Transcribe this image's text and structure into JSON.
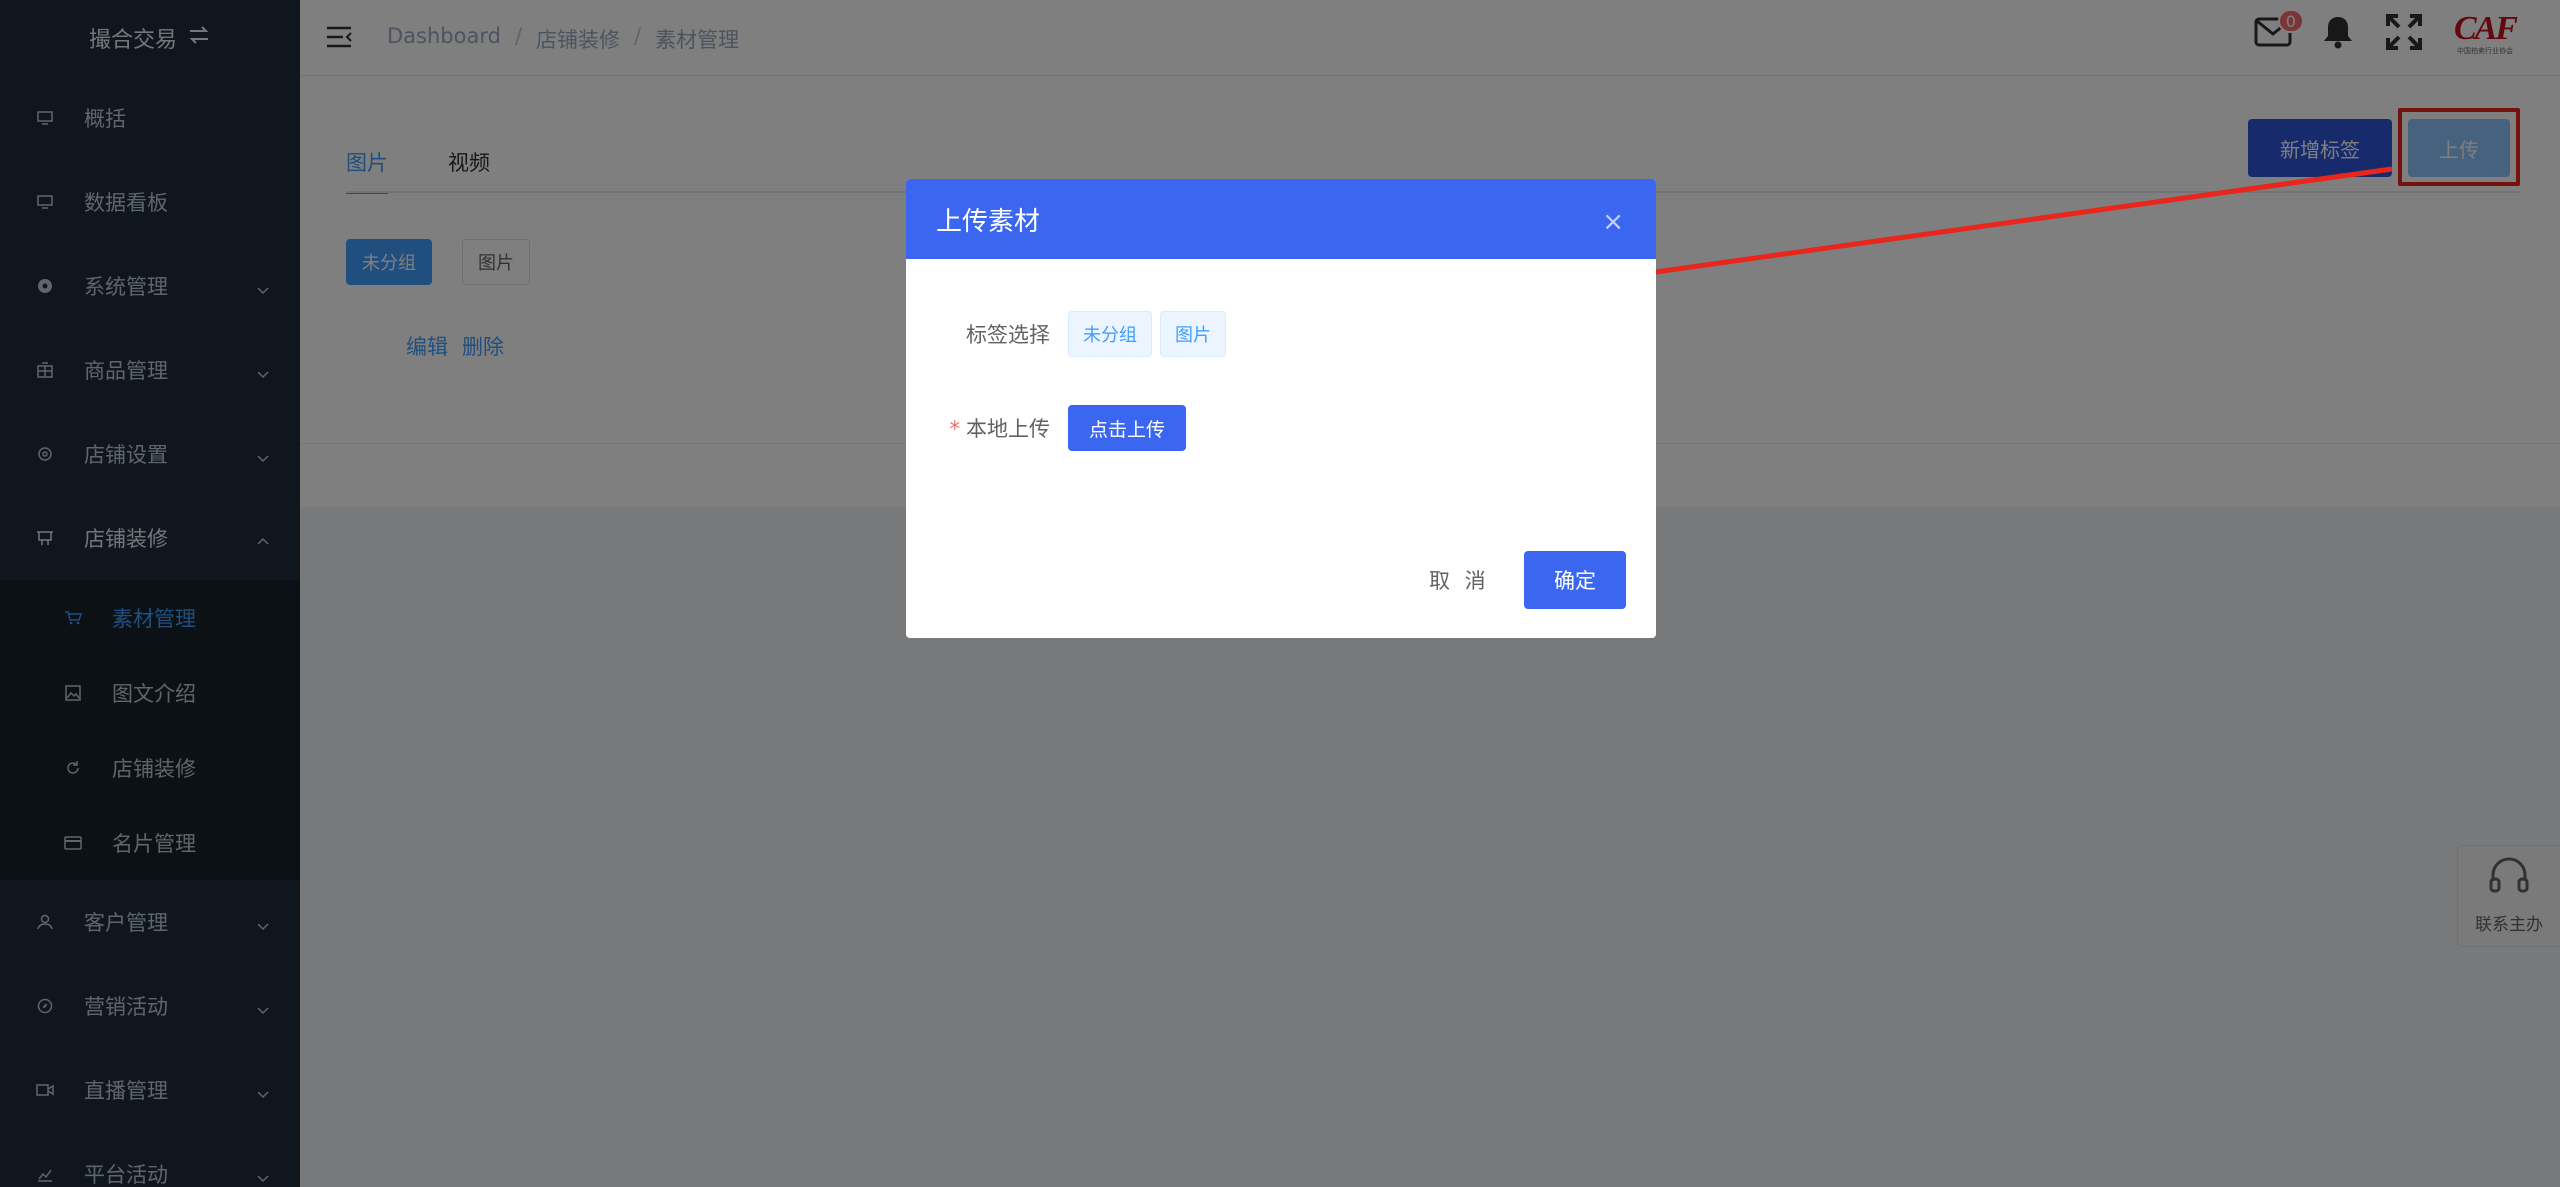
{
  "brand": {
    "label": "撮合交易"
  },
  "sidebar": {
    "items": [
      {
        "label": "概括",
        "icon": "monitor-icon"
      },
      {
        "label": "数据看板",
        "icon": "monitor-icon"
      },
      {
        "label": "系统管理",
        "icon": "settings-circle-icon"
      },
      {
        "label": "商品管理",
        "icon": "grid-icon"
      },
      {
        "label": "店铺设置",
        "icon": "gear-icon"
      },
      {
        "label": "店铺装修",
        "icon": "shop-icon"
      }
    ],
    "subitems": [
      {
        "label": "素材管理",
        "icon": "cart-icon",
        "active": true
      },
      {
        "label": "图文介绍",
        "icon": "image-icon"
      },
      {
        "label": "店铺装修",
        "icon": "refresh-icon"
      },
      {
        "label": "名片管理",
        "icon": "card-icon"
      }
    ],
    "items_after": [
      {
        "label": "客户管理",
        "icon": "user-icon"
      },
      {
        "label": "营销活动",
        "icon": "compass-icon"
      },
      {
        "label": "直播管理",
        "icon": "video-icon"
      },
      {
        "label": "平台活动",
        "icon": "chart-icon"
      }
    ]
  },
  "breadcrumb": [
    "Dashboard",
    "店铺装修",
    "素材管理"
  ],
  "breadcrumb_sep": "/",
  "header": {
    "mail_badge": "0",
    "logo_text": "CAF",
    "logo_subtitle": "中国拍卖行业协会"
  },
  "tabs": [
    {
      "label": "图片",
      "active": true
    },
    {
      "label": "视频",
      "active": false
    }
  ],
  "toolbar": {
    "new_tag_label": "新增标签",
    "upload_label": "上传"
  },
  "tag_filters": [
    {
      "label": "未分组"
    },
    {
      "label": "图片"
    }
  ],
  "row_actions": {
    "edit": "编辑",
    "delete": "删除"
  },
  "dialog": {
    "title": "上传素材",
    "close": "×",
    "tag_label": "标签选择",
    "tag_options": [
      "未分组",
      "图片"
    ],
    "required_mark": "*",
    "upload_label": "本地上传",
    "upload_button": "点击上传",
    "cancel": "取 消",
    "confirm": "确定"
  },
  "contact": {
    "label": "联系主办"
  },
  "colors": {
    "sidebar_bg": "#1f2d3d",
    "accent": "#409eff",
    "dialog_header": "#3a66f0",
    "annotation": "#e8261c"
  }
}
